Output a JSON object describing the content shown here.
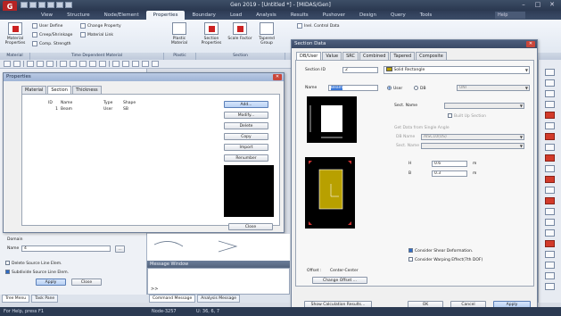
{
  "app": {
    "title": "Gen 2019 - [Untitled *] - [MIDAS/Gen]",
    "logo_letter": "G",
    "help_label": "Help"
  },
  "ribbon": {
    "tabs": [
      {
        "label": "View"
      },
      {
        "label": "Structure"
      },
      {
        "label": "Node/Element"
      },
      {
        "label": "Properties"
      },
      {
        "label": "Boundary"
      },
      {
        "label": "Load"
      },
      {
        "label": "Analysis"
      },
      {
        "label": "Results"
      },
      {
        "label": "Pushover"
      },
      {
        "label": "Design"
      },
      {
        "label": "Query"
      },
      {
        "label": "Tools"
      }
    ],
    "active_tab": "Properties",
    "buttons": {
      "material": "Material Properties",
      "user_define": "User Define",
      "change_property": "Change Property",
      "creep_shrinkage": "Creep/Shrinkage",
      "material_link": "Material Link",
      "comp_strength": "Comp. Strength",
      "plastic_material": "Plastic Material",
      "section_properties": "Section Properties",
      "scale_factor": "Scale Factor",
      "tapered_group": "Tapered Group",
      "thickness": "Thick",
      "inel_control": "Inel. Control Data"
    },
    "groups": [
      "Material",
      "Time Dependent Material",
      "Plastic",
      "Section"
    ]
  },
  "properties_dialog": {
    "title": "Properties",
    "tabs": [
      "Material",
      "Section",
      "Thickness"
    ],
    "active_tab": "Section",
    "columns": [
      "ID",
      "Name",
      "Type",
      "Shape"
    ],
    "rows": [
      {
        "id": "1",
        "name": "Beam",
        "type": "User",
        "shape": "SB"
      }
    ],
    "buttons": {
      "add": "Add...",
      "modify": "Modify...",
      "delete": "Delete",
      "copy": "Copy",
      "import": "Import",
      "renumber": "Renumber",
      "close": "Close"
    }
  },
  "left_panel": {
    "domain_label": "Domain",
    "name_label": "Name",
    "name_value": "4",
    "browse_label": "...",
    "delete_source": "Delete Source Line Elem.",
    "subdivide_source": "Subdivide Source Line Elem.",
    "apply": "Apply",
    "close": "Close",
    "tabs": [
      "Tree Menu",
      "Task Pane"
    ]
  },
  "message_window": {
    "title": "Message Window",
    "prompt": ">>",
    "tabs": [
      "Command Message",
      "Analysis Message"
    ]
  },
  "section_dialog": {
    "title": "Section Data",
    "tabs": [
      "DB/User",
      "Value",
      "SRC",
      "Combined",
      "Tapered",
      "Composite"
    ],
    "active_tab": "DB/User",
    "section_id_label": "Section ID",
    "section_id_value": "2",
    "shape_value": "Solid Rectangle",
    "name_label": "Name",
    "name_value": "Beam",
    "radio_user": "User",
    "radio_db": "DB",
    "db_value": "UNI",
    "sect_name_label": "Sect. Name",
    "built_up": "Built Up Section",
    "get_data_label": "Get Data from Single Angle",
    "db_name_label": "DB Name",
    "db_name_value": "AISC10(US)",
    "sect_name2_label": "Sect. Name",
    "h_label": "H",
    "h_value": "0.6",
    "h_unit": "m",
    "b_label": "B",
    "b_value": "0.3",
    "b_unit": "m",
    "consider_shear": "Consider Shear Deformation.",
    "consider_warping": "Consider Warping Effect(7th DOF)",
    "offset_label": "Offset :",
    "offset_value": "Center-Center",
    "change_offset": "Change Offset ...",
    "show_calc": "Show Calculation Results...",
    "ok": "OK",
    "cancel": "Cancel",
    "apply": "Apply"
  },
  "status": {
    "help": "For Help, press F1",
    "node": "Node-3257",
    "units": "U: 36, 6, 7"
  },
  "colors": {
    "accent": "#2d6bc6",
    "section_fill": "#b8a000",
    "preview_bg": "#000000",
    "titlebar": "#2a3850"
  }
}
